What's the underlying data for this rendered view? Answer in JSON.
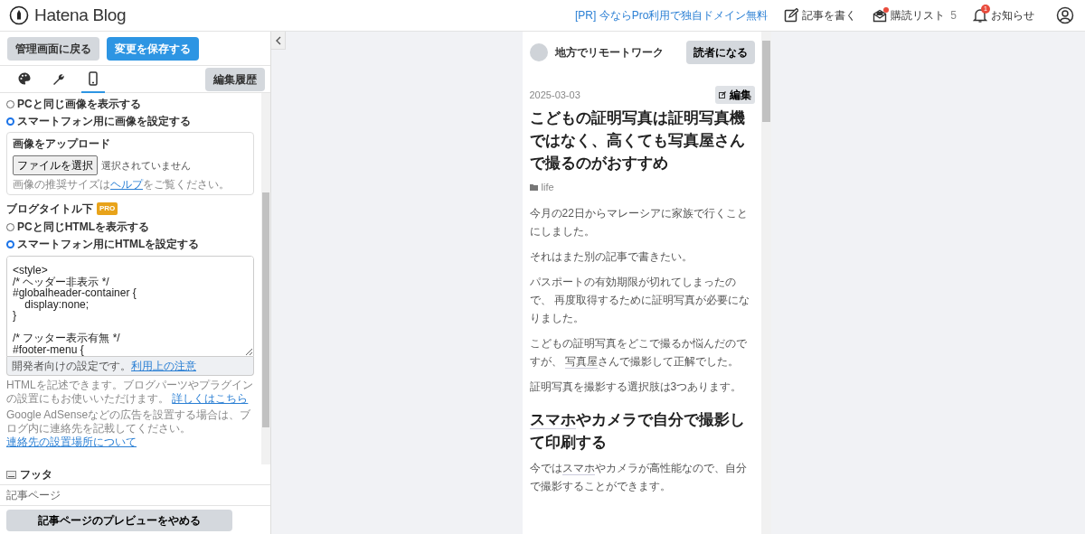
{
  "header": {
    "logo": "Hatena Blog",
    "pr_link": "[PR] 今ならPro利用で独自ドメイン無料",
    "nav": [
      {
        "kind": "write",
        "label": "記事を書く"
      },
      {
        "kind": "reading",
        "label": "購読リスト",
        "count": "5",
        "dot": true
      },
      {
        "kind": "notice",
        "label": "お知らせ",
        "badge": "1"
      },
      {
        "kind": "user"
      }
    ]
  },
  "sidebar": {
    "buttons": [
      {
        "label": "管理画面に戻る",
        "kind": "secondary"
      },
      {
        "label": "変更を保存する",
        "kind": "primary"
      }
    ],
    "tabs": [
      {
        "kind": "design",
        "selected": false
      },
      {
        "kind": "custom",
        "selected": false
      },
      {
        "kind": "smartphone",
        "selected": true
      }
    ],
    "history_button": "編集履歴",
    "header_image_options": [
      {
        "label": "PCと同じ画像を表示する",
        "selected": false
      },
      {
        "label": "スマートフォン用に画像を設定する",
        "selected": true
      }
    ],
    "upload": {
      "label": "画像をアップロード",
      "button": "ファイルを選択",
      "status": "選択されていません",
      "hint": [
        {
          "text": "画像の推奨サイズは"
        },
        {
          "text": "ヘルプ",
          "link": true
        },
        {
          "text": "をご覧ください。"
        }
      ]
    },
    "below_title": {
      "title": "ブログタイトル下",
      "badge": "PRO",
      "options": [
        {
          "label": "PCと同じHTMLを表示する",
          "selected": false
        },
        {
          "label": "スマートフォン用にHTMLを設定する",
          "selected": true
        }
      ],
      "code": "<style>\n/* ヘッダー非表示 */\n#globalheader-container {\n    display:none;\n}\n\n/* フッター表示有無 */\n#footer-menu {",
      "note": [
        {
          "text": "開発者向けの設定です。"
        },
        {
          "text": "利用上の注意",
          "link": true
        }
      ],
      "help": [
        {
          "text": "HTMLを記述できます。ブログパーツやプラグインの設置にもお使いいただけます。 "
        },
        {
          "text": "詳しくはこちら",
          "link": true
        }
      ],
      "adsense": [
        {
          "text": "Google AdSenseなどの広告を設置する場合は、ブログ内に連絡先を記載してください。"
        },
        {
          "text": "連絡先の設置場所について",
          "link": true
        }
      ]
    },
    "footer_section": "フッタ",
    "page_section": "記事ページ",
    "preview_button": "記事ページのプレビューをやめる"
  },
  "preview": {
    "blog_name": "地方でリモートワーク",
    "subscribe": "読者になる",
    "date": "2025-03-03",
    "edit": "編集",
    "title": "こどもの証明写真は証明写真機ではなく、高くても写真屋さんで撮るのがおすすめ",
    "category": "life",
    "blocks": [
      {
        "kind": "p",
        "parts": [
          {
            "text": "今月の22日からマレーシアに家族で行くことにしました。"
          }
        ]
      },
      {
        "kind": "p",
        "parts": [
          {
            "text": "それはまた別の記事で書きたい。"
          }
        ]
      },
      {
        "kind": "p",
        "parts": [
          {
            "text": "パスポートの有効期限が切れてしまったので、 再度取得するために証明写真が必要になりました。"
          }
        ]
      },
      {
        "kind": "p",
        "parts": [
          {
            "text": "こどもの証明写真をどこで撮るか悩んだのですが、 "
          },
          {
            "text": "写真屋",
            "link": true
          },
          {
            "text": "さんで撮影して正解でした。"
          }
        ]
      },
      {
        "kind": "p",
        "parts": [
          {
            "text": "証明写真を撮影する選択肢は3つあります。"
          }
        ]
      },
      {
        "kind": "h",
        "parts": [
          {
            "text": "スマホ",
            "link": true
          },
          {
            "text": "やカメラで自分で撮影して印刷する"
          }
        ]
      },
      {
        "kind": "p",
        "parts": [
          {
            "text": "今では"
          },
          {
            "text": "スマホ",
            "link": true
          },
          {
            "text": "やカメラが高性能なので、自分で撮影することができます。"
          }
        ]
      }
    ]
  }
}
